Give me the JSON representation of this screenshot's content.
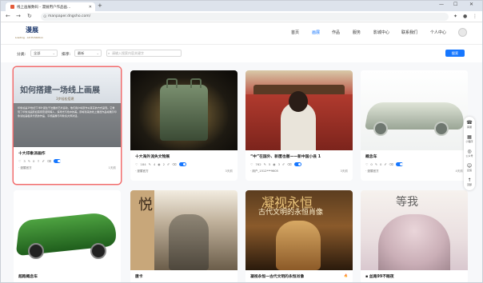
{
  "browser": {
    "tab_title": "线上画展数码 - 漫展用户作品画…",
    "url": "manpaper.dngsho.com/",
    "new_tab": "+",
    "win_min": "—",
    "win_max": "☐",
    "win_close": "✕"
  },
  "site": {
    "logo_mark": "漫展",
    "logo_sub": "Loading · Art Exhibition",
    "nav": [
      "首页",
      "画展",
      "作品",
      "服务",
      "影城中心",
      "联系我们",
      "个人中心"
    ],
    "nav_active_index": 1
  },
  "filter": {
    "category_label": "分类:",
    "category_value": "全部",
    "sort_label": "排序:",
    "sort_value": "最新",
    "search_placeholder": "请输入搜索内容关键字",
    "search_button": "搜索"
  },
  "cards": [
    {
      "title": "十大印象派画作",
      "image_heading": "如何搭建一场线上画展",
      "image_sub": "3步轻松搭建",
      "image_text": "印象派是19世纪下半叶诞生于法国的艺术运动，他们用户将原作以真实的方式呈现。它重现了印象派画家如莫奈雷诺阿等人，探寻光与色中的美。即将到来的线上展览作品将展示印象派绘画极具代表的作品，平视画展与印象派大师对话。",
      "likes": "3",
      "comments": "0",
      "author": "漫展官方",
      "time": "1天前"
    },
    {
      "title": "十大海外流失文物展",
      "likes": "184",
      "comments": "4",
      "views": "2",
      "author": "漫展官方",
      "time": "3天前"
    },
    {
      "title": "“中”在国外、新匿也撤——新中国小县 1",
      "likes": "762",
      "comments": "5",
      "views": "3",
      "author": "用户_1512***9605",
      "time": "3天前"
    },
    {
      "title": "概念车",
      "likes": "0",
      "comments": "0",
      "author": "漫展官方",
      "time": "4天前"
    },
    {
      "title": "超跑概念车"
    },
    {
      "title": "唐卡"
    },
    {
      "title": "凝视永恒—古代文明的永恒肖像",
      "image_t1": "凝视永恒",
      "image_t2": "古代文明的永恒肖像"
    },
    {
      "title": "丝路99不眠夜",
      "image_call": "等我"
    }
  ],
  "sidebar": [
    {
      "icon": "☎",
      "label": "客服"
    },
    {
      "icon": "▦",
      "label": "小程序"
    },
    {
      "icon": "◎",
      "label": "公众号"
    },
    {
      "icon": "☺",
      "label": "反馈"
    },
    {
      "icon": "↑",
      "label": "顶部"
    }
  ],
  "colors": {
    "accent": "#1677ff",
    "selection": "#f26d6d"
  }
}
